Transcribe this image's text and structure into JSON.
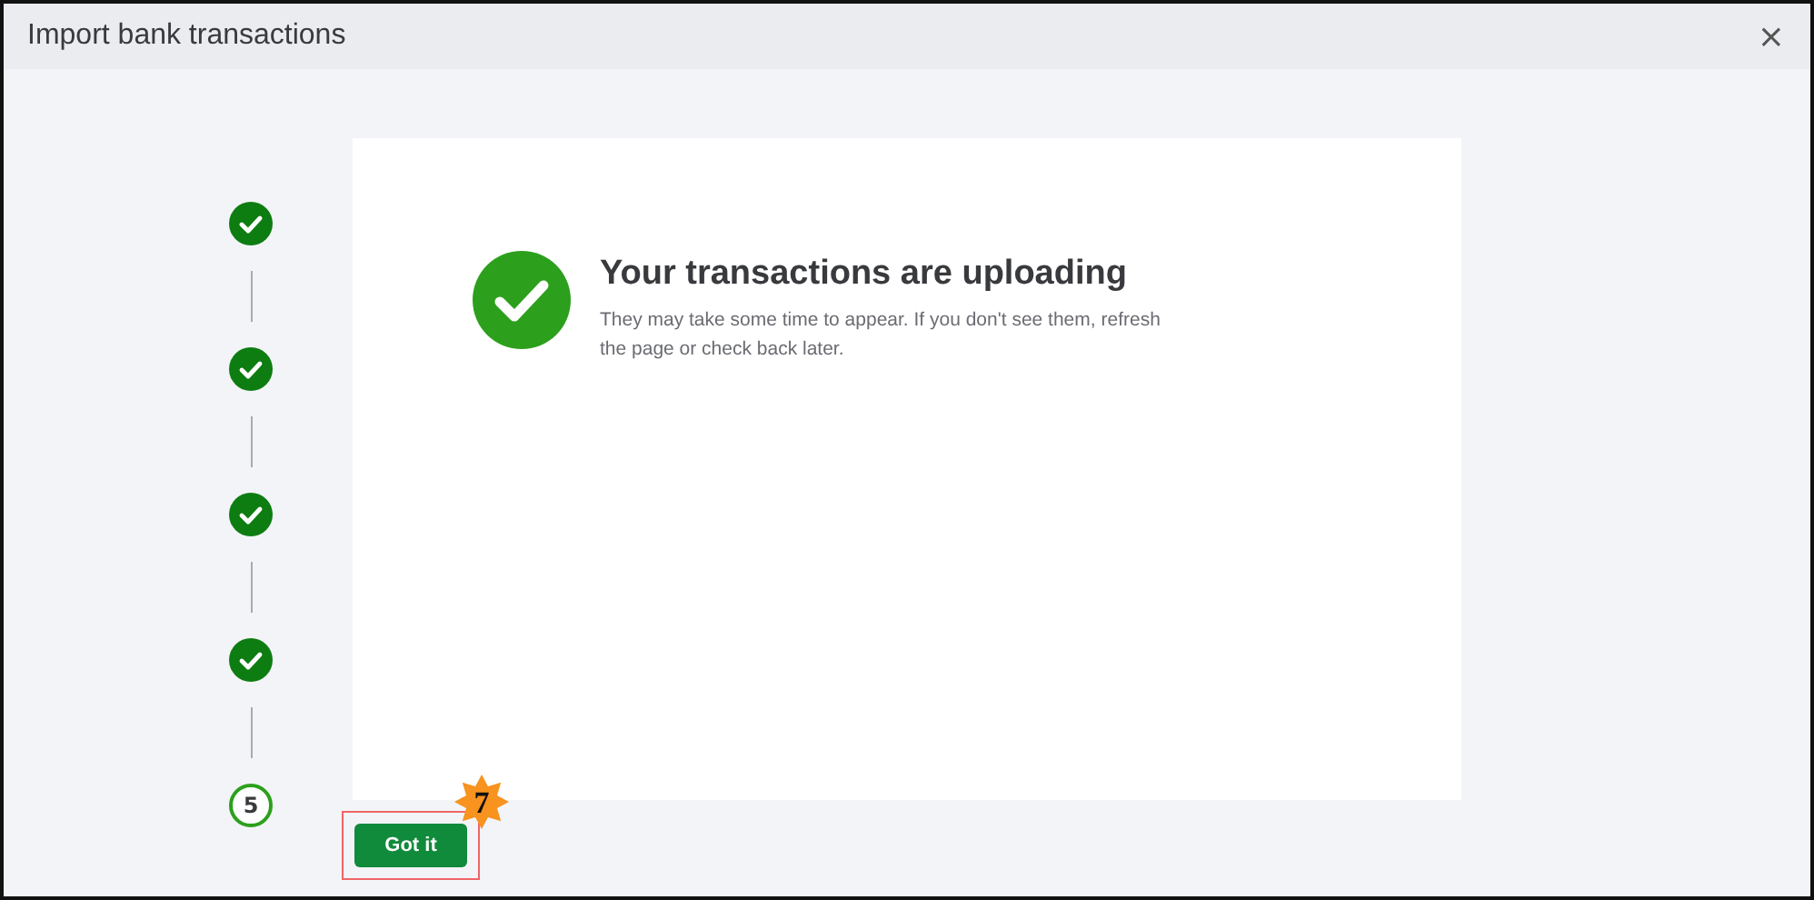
{
  "window": {
    "title": "Import bank transactions",
    "close": "×"
  },
  "steps": [
    {
      "kind": "done"
    },
    {
      "kind": "done"
    },
    {
      "kind": "done"
    },
    {
      "kind": "done"
    },
    {
      "kind": "current",
      "label": "5"
    }
  ],
  "message": {
    "title": "Your transactions are uploading",
    "body": "They may take some time to appear. If you don't see them, refresh the page or check back later."
  },
  "button": {
    "label": "Got it",
    "highlighted": true
  },
  "callout": {
    "label": "7"
  }
}
